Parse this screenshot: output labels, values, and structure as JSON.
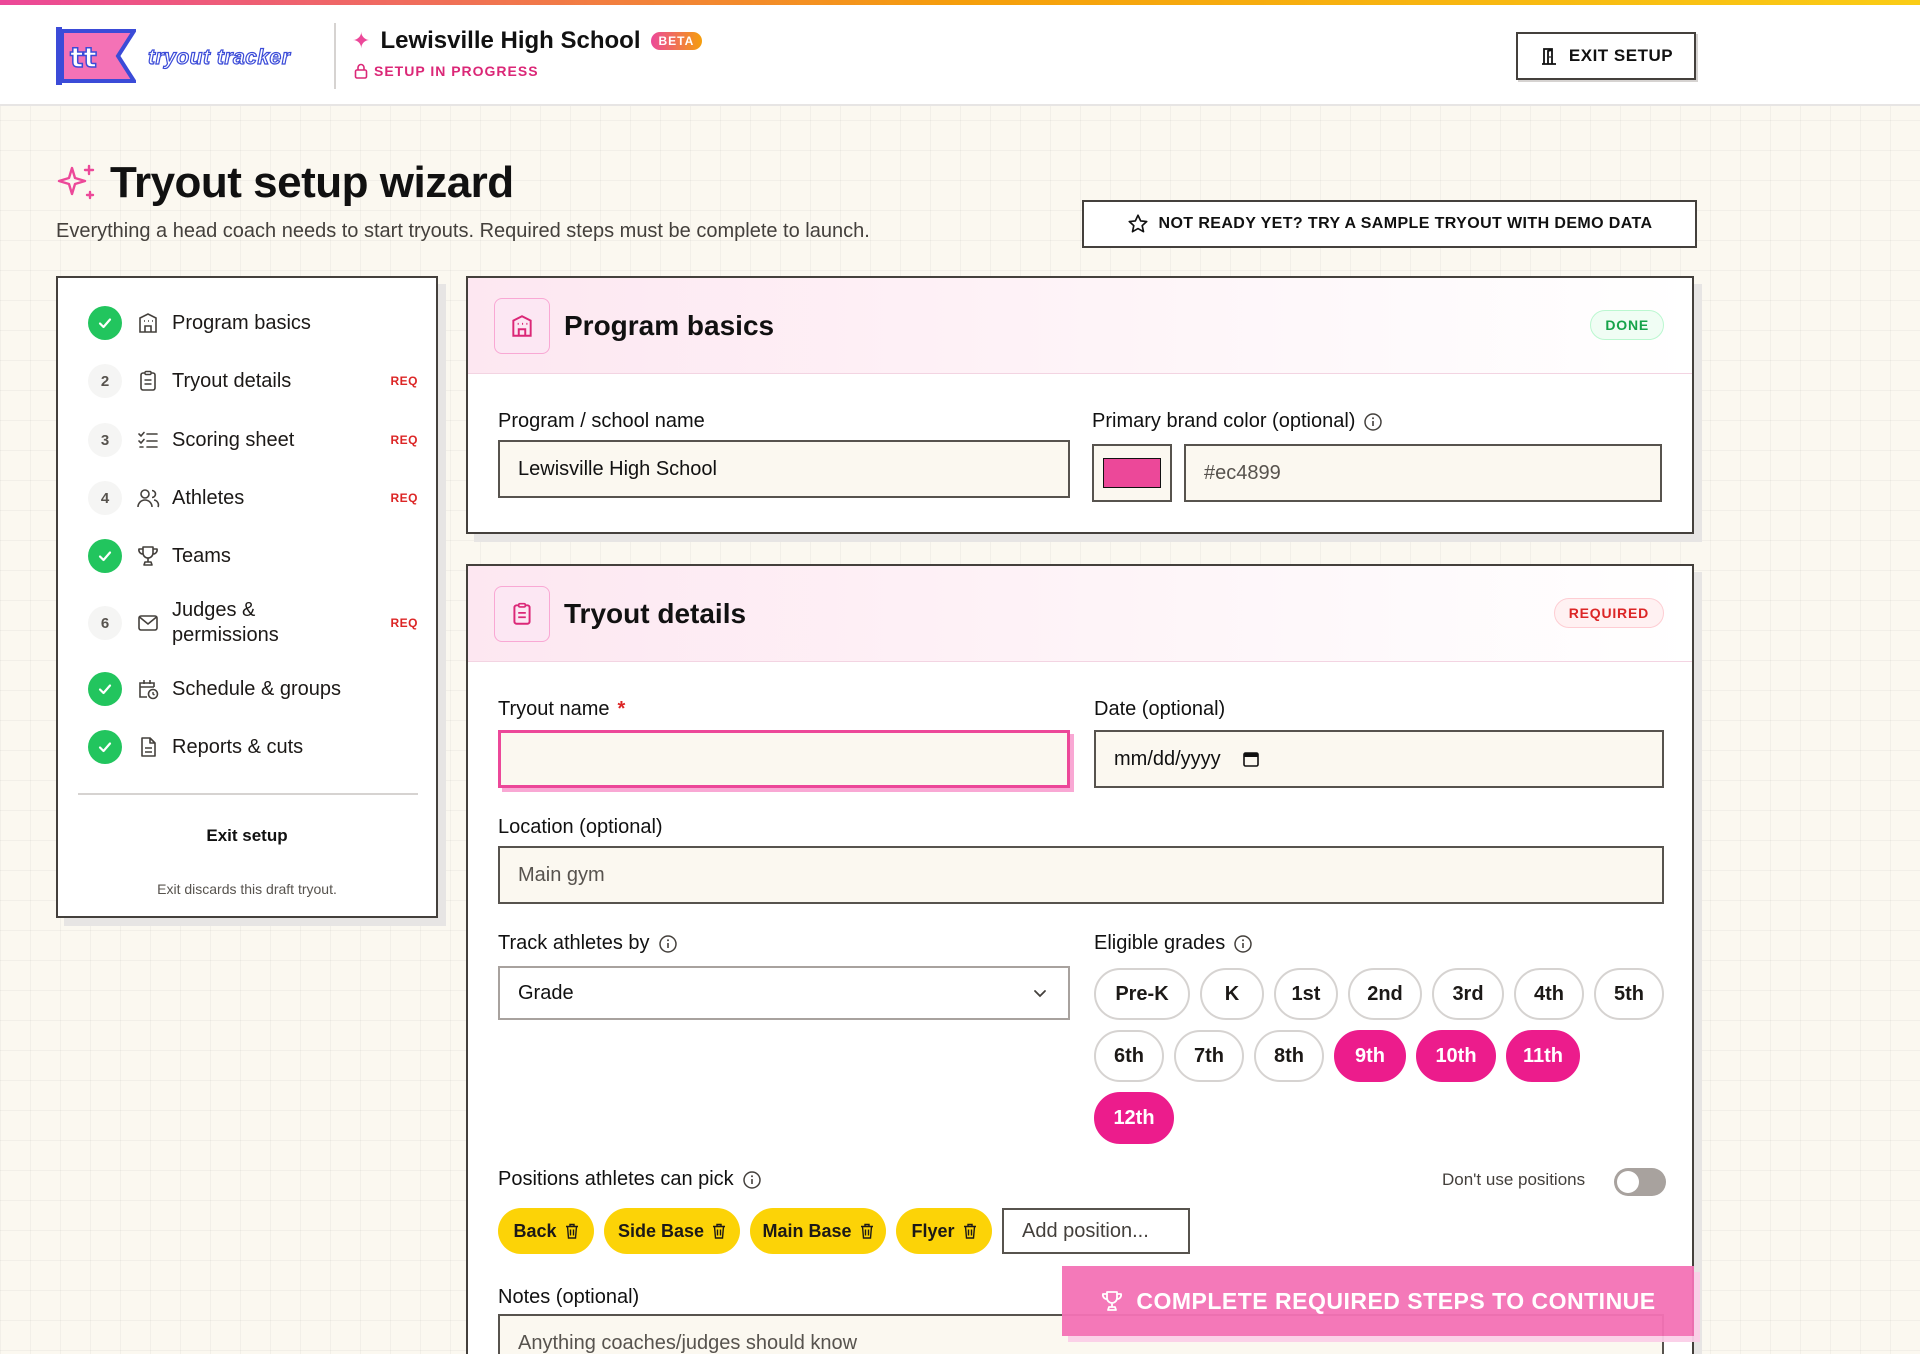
{
  "header": {
    "logo_text": "tryout tracker",
    "school_name": "Lewisville High School",
    "beta_badge": "BETA",
    "setup_status": "SETUP IN PROGRESS",
    "exit_button": "EXIT SETUP"
  },
  "page": {
    "title": "Tryout setup wizard",
    "subtitle": "Everything a head coach needs to start tryouts. Required steps must be complete to launch.",
    "sample_button": "NOT READY YET? TRY A SAMPLE TRYOUT WITH DEMO DATA"
  },
  "sidebar": {
    "steps": [
      {
        "num": "",
        "label": "Program basics",
        "done": true,
        "req": "",
        "icon": "building-icon"
      },
      {
        "num": "2",
        "label": "Tryout details",
        "done": false,
        "req": "REQ",
        "icon": "clipboard-icon"
      },
      {
        "num": "3",
        "label": "Scoring sheet",
        "done": false,
        "req": "REQ",
        "icon": "checklist-icon"
      },
      {
        "num": "4",
        "label": "Athletes",
        "done": false,
        "req": "REQ",
        "icon": "users-icon"
      },
      {
        "num": "",
        "label": "Teams",
        "done": true,
        "req": "",
        "icon": "trophy-icon"
      },
      {
        "num": "6",
        "label": "Judges & permissions",
        "done": false,
        "req": "REQ",
        "icon": "mail-icon"
      },
      {
        "num": "",
        "label": "Schedule & groups",
        "done": true,
        "req": "",
        "icon": "calendar-clock-icon"
      },
      {
        "num": "",
        "label": "Reports & cuts",
        "done": true,
        "req": "",
        "icon": "document-icon"
      }
    ],
    "exit_label": "Exit setup",
    "exit_note": "Exit discards this draft tryout."
  },
  "program_basics": {
    "title": "Program basics",
    "status": "DONE",
    "school_name_label": "Program / school name",
    "school_name_value": "Lewisville High School",
    "brand_color_label": "Primary brand color (optional)",
    "brand_color_value": "#ec4899"
  },
  "tryout_details": {
    "title": "Tryout details",
    "status": "REQUIRED",
    "tryout_name_label": "Tryout name",
    "tryout_name_required_mark": "*",
    "tryout_name_value": "",
    "date_label": "Date (optional)",
    "date_placeholder": "mm/dd/yyyy",
    "location_label": "Location (optional)",
    "location_placeholder": "Main gym",
    "track_label": "Track athletes by",
    "track_value": "Grade",
    "grades_label": "Eligible grades",
    "grades": [
      {
        "label": "Pre-K",
        "selected": false
      },
      {
        "label": "K",
        "selected": false
      },
      {
        "label": "1st",
        "selected": false
      },
      {
        "label": "2nd",
        "selected": false
      },
      {
        "label": "3rd",
        "selected": false
      },
      {
        "label": "4th",
        "selected": false
      },
      {
        "label": "5th",
        "selected": false
      },
      {
        "label": "6th",
        "selected": false
      },
      {
        "label": "7th",
        "selected": false
      },
      {
        "label": "8th",
        "selected": false
      },
      {
        "label": "9th",
        "selected": true
      },
      {
        "label": "10th",
        "selected": true
      },
      {
        "label": "11th",
        "selected": true
      },
      {
        "label": "12th",
        "selected": true
      }
    ],
    "positions_label": "Positions athletes can pick",
    "no_positions_label": "Don't use positions",
    "no_positions_on": false,
    "positions": [
      "Back",
      "Side Base",
      "Main Base",
      "Flyer"
    ],
    "add_position_placeholder": "Add position...",
    "notes_label": "Notes (optional)",
    "notes_placeholder": "Anything coaches/judges should know"
  },
  "cta": {
    "label": "COMPLETE REQUIRED STEPS TO CONTINUE"
  },
  "colors": {
    "accent": "#ec4899",
    "selected_grade": "#ec1c8c",
    "position_chip": "#fcd307",
    "done_green": "#22c55e",
    "required_red": "#dc2626"
  }
}
